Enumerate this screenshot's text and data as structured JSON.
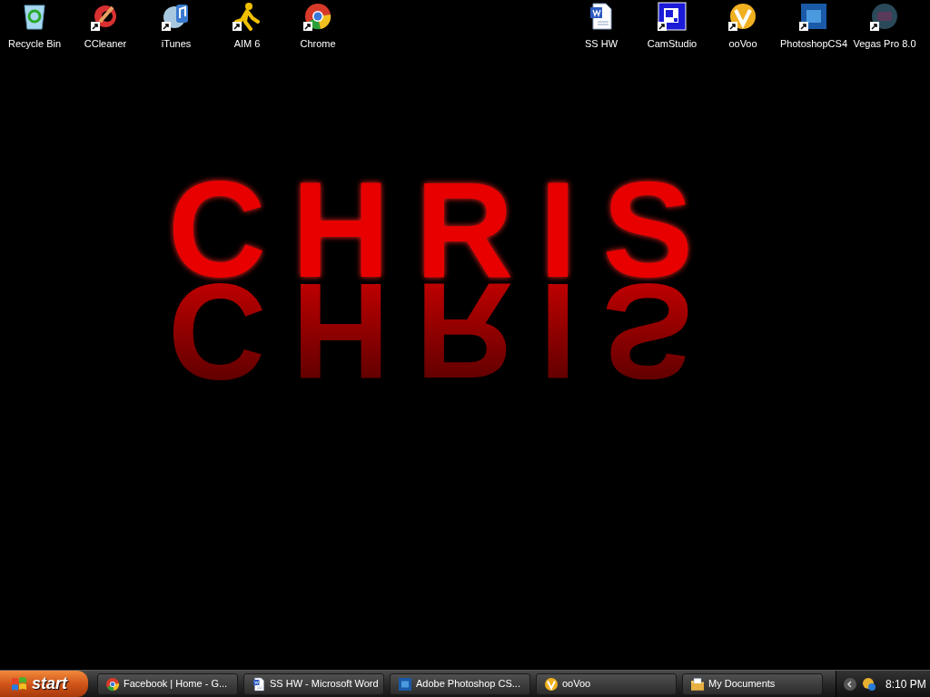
{
  "desktop_icons_left": [
    {
      "label": "Recycle Bin",
      "kind": "recycle",
      "shortcut": false
    },
    {
      "label": "CCleaner",
      "kind": "ccleaner",
      "shortcut": true
    },
    {
      "label": "iTunes",
      "kind": "itunes",
      "shortcut": true
    },
    {
      "label": "AIM 6",
      "kind": "aim",
      "shortcut": true
    },
    {
      "label": "Chrome",
      "kind": "chrome",
      "shortcut": true
    }
  ],
  "desktop_icons_right": [
    {
      "label": "SS HW",
      "kind": "word",
      "shortcut": false
    },
    {
      "label": "CamStudio",
      "kind": "camstudio",
      "shortcut": true
    },
    {
      "label": "ooVoo",
      "kind": "oovoo",
      "shortcut": true
    },
    {
      "label": "PhotoshopCS4",
      "kind": "photoshop",
      "shortcut": true
    },
    {
      "label": "Vegas Pro 8.0",
      "kind": "vegas",
      "shortcut": true
    }
  ],
  "wallpaper": {
    "text": "CHRIS",
    "reflection": "CHRIS"
  },
  "taskbar": {
    "start_button": "start",
    "tasks": [
      {
        "label": "Facebook | Home - G...",
        "kind": "chrome"
      },
      {
        "label": "SS HW - Microsoft Word",
        "kind": "word"
      },
      {
        "label": "Adobe Photoshop CS...",
        "kind": "photoshop"
      },
      {
        "label": "ooVoo",
        "kind": "oovoo"
      },
      {
        "label": "My Documents",
        "kind": "folder"
      }
    ],
    "clock": "8:10 PM"
  }
}
